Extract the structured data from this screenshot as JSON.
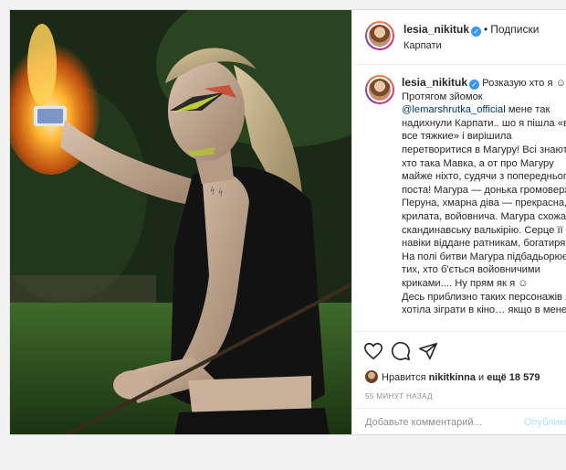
{
  "post": {
    "username": "lesia_nikituk",
    "follow_label": "Подписки",
    "location": "Карпати",
    "caption": {
      "intro": "Розказую хто я",
      "lines_before_mention": "Протягом зйомок",
      "mention": "@lemarshrutka_official",
      "body": "мене так надихнули Карпати.. шо я пішла «во все тяжкие» і вирішила перетворитися в Магуру! Всі знають хто така Мавка, а от про Магуру майже ніхто, судячи з попереднього поста! Магура — донька громовержця Перуна, хмарна діва — прекрасна, крилата, войовнича. Магура схожа на скандинавську валькірію. Серце її навіки віддане ратникам, богатирям. На полі битви Магура підбадьорює тих, хто б'ється войовничими криками.... Ну прям як я",
      "tail": "Десь приблизно таких персонажів я б хотіла зіграти в кіно… якщо в мене"
    },
    "likes": {
      "prefix": "Нравится",
      "user": "nikitkinna",
      "middle": "и",
      "others": "ещё 18 579"
    },
    "time": "55 МИНУТ НАЗАД",
    "comment_placeholder": "Добавьте комментарий...",
    "publish_label": "Опубликовать"
  },
  "icons": {
    "like": "heart-icon",
    "comment": "comment-icon",
    "share": "paper-plane-icon",
    "save": "bookmark-icon",
    "verified": "verified-badge-icon"
  },
  "colors": {
    "verified": "#3897f0",
    "mention": "#00376b",
    "publish_disabled": "#b2dffc"
  }
}
